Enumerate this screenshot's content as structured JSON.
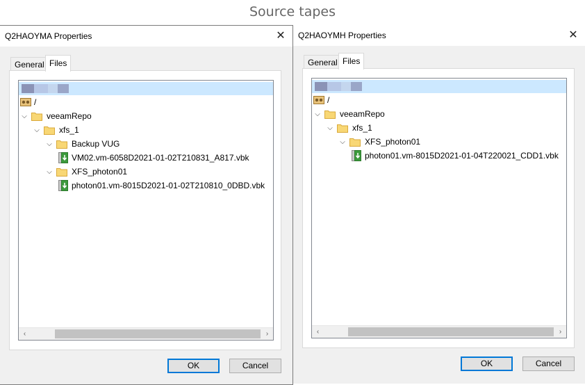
{
  "caption": "Source tapes",
  "dialogs": [
    {
      "title": "Q2HAOYMA Properties",
      "close_glyph": "✕",
      "tabs": [
        "General",
        "Files"
      ],
      "active_tab": "Files",
      "tree": {
        "root_label": "/",
        "items": [
          {
            "label": "veeamRepo",
            "type": "folder",
            "level": 1,
            "expanded": true
          },
          {
            "label": "xfs_1",
            "type": "folder",
            "level": 2,
            "expanded": true
          },
          {
            "label": "Backup VUG",
            "type": "folder",
            "level": 3,
            "expanded": true
          },
          {
            "label": "VM02.vm-6058D2021-01-02T210831_A817.vbk",
            "type": "file",
            "level": 4
          },
          {
            "label": "XFS_photon01",
            "type": "folder",
            "level": 3,
            "expanded": true
          },
          {
            "label": "photon01.vm-8015D2021-01-02T210810_0DBD.vbk",
            "type": "file",
            "level": 4
          }
        ]
      },
      "buttons": {
        "ok": "OK",
        "cancel": "Cancel"
      }
    },
    {
      "title": "Q2HAOYMH Properties",
      "close_glyph": "✕",
      "tabs": [
        "General",
        "Files"
      ],
      "active_tab": "Files",
      "tree": {
        "root_label": "/",
        "items": [
          {
            "label": "veeamRepo",
            "type": "folder",
            "level": 1,
            "expanded": true
          },
          {
            "label": "xfs_1",
            "type": "folder",
            "level": 2,
            "expanded": true
          },
          {
            "label": "XFS_photon01",
            "type": "folder",
            "level": 3,
            "expanded": true
          },
          {
            "label": "photon01.vm-8015D2021-01-04T220021_CDD1.vbk",
            "type": "file",
            "level": 4
          }
        ]
      },
      "buttons": {
        "ok": "OK",
        "cancel": "Cancel"
      }
    }
  ],
  "icons": {
    "folder": "folder-icon",
    "backup_file": "vbk-file-icon",
    "tape_root": "tape-root-icon",
    "expand": "chevron-down-icon",
    "scroll_left": "scroll-left-icon",
    "scroll_right": "scroll-right-icon"
  },
  "colors": {
    "selection": "#cce8ff",
    "default_button_border": "#0078d7",
    "folder": "#f8d775",
    "vbk_green": "#3c9a3c"
  }
}
